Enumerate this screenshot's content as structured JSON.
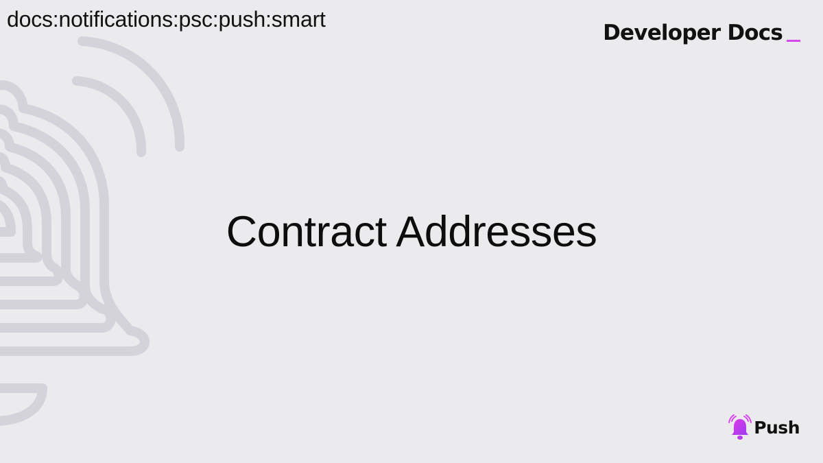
{
  "breadcrumb": {
    "text": "docs:notifications:psc:push:smart"
  },
  "brand": {
    "title": "Developer Docs",
    "cursor_color": "#d548ec"
  },
  "main": {
    "title": "Contract Addresses"
  },
  "logo": {
    "name": "Push",
    "icon": "bell-icon",
    "gradient_start": "#e03ae8",
    "gradient_end": "#9b3cf0"
  },
  "colors": {
    "background": "#ebebed",
    "decor_stroke": "#d4d2db"
  }
}
